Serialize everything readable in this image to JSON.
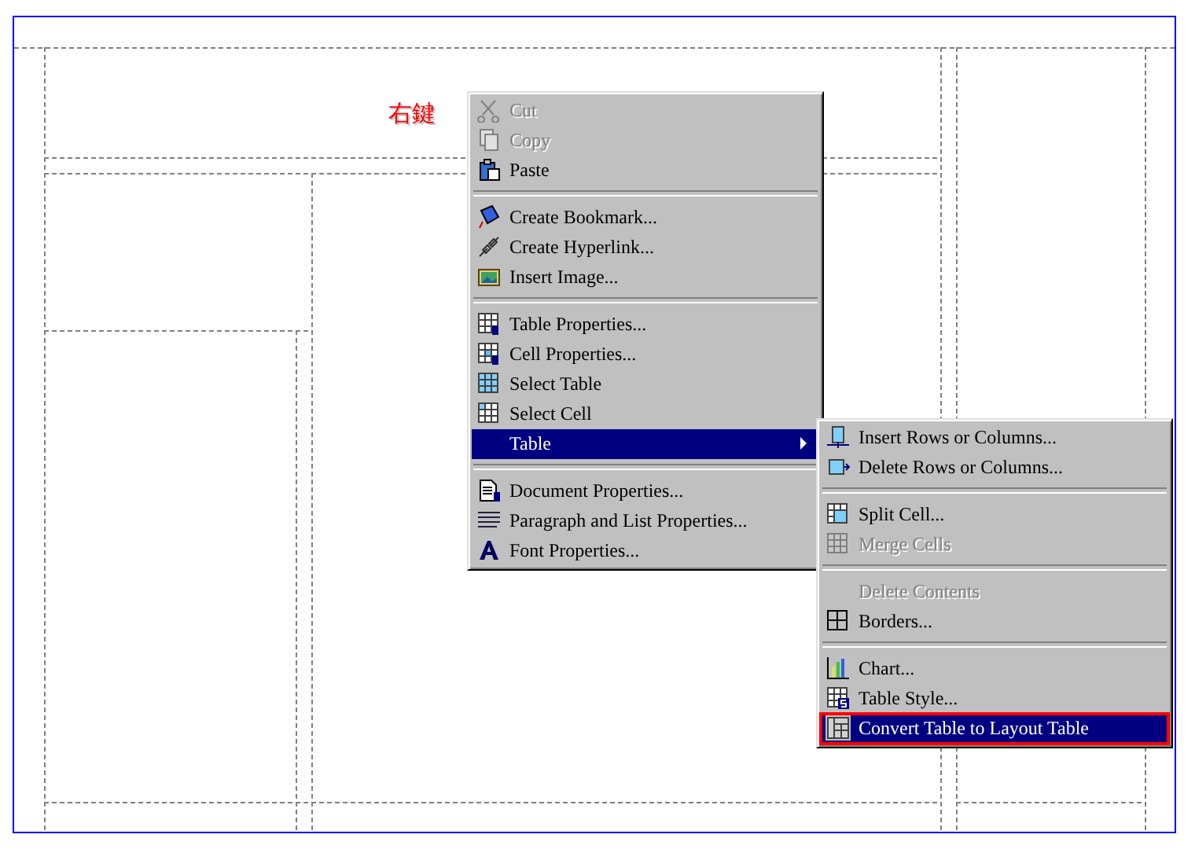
{
  "canvas": {
    "label": "右鍵"
  },
  "context_menu": {
    "items": [
      {
        "kind": "item",
        "label": "Cut",
        "disabled": true,
        "selected": false
      },
      {
        "kind": "item",
        "label": "Copy",
        "disabled": true,
        "selected": false
      },
      {
        "kind": "item",
        "label": "Paste",
        "disabled": false,
        "selected": false
      },
      {
        "kind": "separator"
      },
      {
        "kind": "item",
        "label": "Create Bookmark...",
        "disabled": false,
        "selected": false
      },
      {
        "kind": "item",
        "label": "Create Hyperlink...",
        "disabled": false,
        "selected": false
      },
      {
        "kind": "item",
        "label": "Insert Image...",
        "disabled": false,
        "selected": false
      },
      {
        "kind": "separator"
      },
      {
        "kind": "item",
        "label": "Table Properties...",
        "disabled": false,
        "selected": false
      },
      {
        "kind": "item",
        "label": "Cell Properties...",
        "disabled": false,
        "selected": false
      },
      {
        "kind": "item",
        "label": "Select Table",
        "disabled": false,
        "selected": false
      },
      {
        "kind": "item",
        "label": "Select Cell",
        "disabled": false,
        "selected": false
      },
      {
        "kind": "submenu",
        "label": "Table",
        "disabled": false,
        "selected": true,
        "items": [
          {
            "kind": "item",
            "label": "Insert Rows or Columns...",
            "disabled": false,
            "selected": false,
            "highlighted": false
          },
          {
            "kind": "item",
            "label": "Delete Rows or Columns...",
            "disabled": false,
            "selected": false,
            "highlighted": false
          },
          {
            "kind": "separator"
          },
          {
            "kind": "item",
            "label": "Split Cell...",
            "disabled": false,
            "selected": false,
            "highlighted": false
          },
          {
            "kind": "item",
            "label": "Merge Cells",
            "disabled": true,
            "selected": false,
            "highlighted": false
          },
          {
            "kind": "separator"
          },
          {
            "kind": "item",
            "label": "Delete Contents",
            "disabled": true,
            "selected": false,
            "highlighted": false
          },
          {
            "kind": "item",
            "label": "Borders...",
            "disabled": false,
            "selected": false,
            "highlighted": false
          },
          {
            "kind": "separator"
          },
          {
            "kind": "item",
            "label": "Chart...",
            "disabled": false,
            "selected": false,
            "highlighted": false
          },
          {
            "kind": "item",
            "label": "Table Style...",
            "disabled": false,
            "selected": false,
            "highlighted": false
          },
          {
            "kind": "item",
            "label": "Convert Table to Layout Table",
            "disabled": false,
            "selected": true,
            "highlighted": true
          }
        ]
      },
      {
        "kind": "separator"
      },
      {
        "kind": "item",
        "label": "Document Properties...",
        "disabled": false,
        "selected": false
      },
      {
        "kind": "item",
        "label": "Paragraph and List Properties...",
        "disabled": false,
        "selected": false
      },
      {
        "kind": "item",
        "label": "Font Properties...",
        "disabled": false,
        "selected": false
      }
    ]
  }
}
